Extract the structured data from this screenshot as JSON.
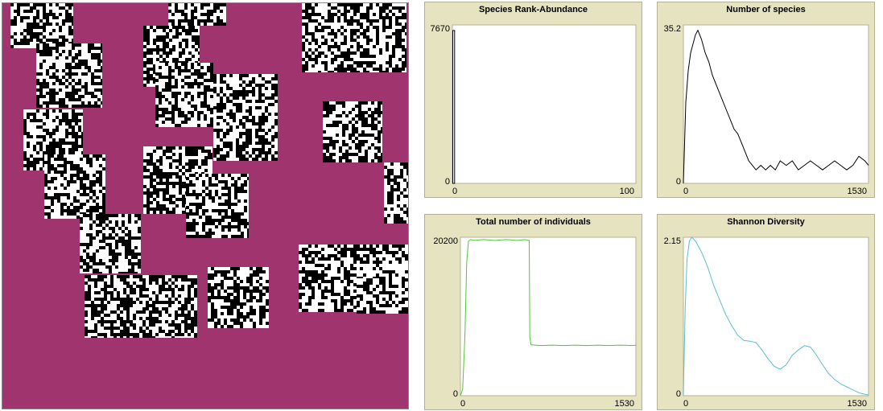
{
  "colors": {
    "world_background": "#a0346e",
    "cell_black": "#000000",
    "cell_white": "#ffffff",
    "species_line": "#000000",
    "individuals_line": "#54c43a",
    "diversity_line": "#5cbfd0",
    "panel_bg": "#e6e3c1"
  },
  "plots": [
    {
      "title": "Species Rank-Abundance",
      "y_max": "7670",
      "y_min": "0",
      "x_min": "0",
      "x_max": "100",
      "chart_data": {
        "type": "bar",
        "title": "Species Rank-Abundance",
        "xlim": [
          0,
          100
        ],
        "ylim": [
          0,
          7670
        ],
        "x": [
          1
        ],
        "values": [
          7400
        ]
      }
    },
    {
      "title": "Number of species",
      "y_max": "35.2",
      "y_min": "0",
      "x_min": "0",
      "x_max": "1530",
      "chart_data": {
        "type": "line",
        "title": "Number of species",
        "xlim": [
          0,
          1530
        ],
        "ylim": [
          0,
          35.2
        ],
        "series": [
          {
            "x": [
              0,
              20,
              40,
              60,
              80,
              100,
              120,
              150,
              180,
              210,
              240,
              270,
              300,
              330,
              360,
              390,
              420,
              450,
              480,
              510,
              540,
              570,
              600,
              640,
              680,
              720,
              760,
              800,
              850,
              900,
              950,
              1000,
              1050,
              1100,
              1150,
              1200,
              1250,
              1300,
              1350,
              1400,
              1450,
              1500,
              1530
            ],
            "values": [
              0,
              18,
              25,
              29,
              31,
              33,
              34,
              32,
              29,
              27,
              24,
              22,
              20,
              18,
              16,
              14,
              12,
              11,
              9,
              7,
              5,
              4,
              3,
              4,
              3,
              4,
              3,
              5,
              4,
              5,
              3,
              4,
              5,
              4,
              3,
              4,
              5,
              4,
              3,
              4,
              6,
              5,
              4
            ]
          }
        ]
      }
    },
    {
      "title": "Total number of individuals",
      "y_max": "20200",
      "y_min": "0",
      "x_min": "0",
      "x_max": "1530",
      "chart_data": {
        "type": "line",
        "title": "Total number of individuals",
        "xlim": [
          0,
          1530
        ],
        "ylim": [
          0,
          20200
        ],
        "series": [
          {
            "x": [
              0,
              20,
              40,
              55,
              70,
              90,
              120,
              200,
              300,
              400,
              500,
              560,
              600,
              605,
              615,
              700,
              800,
              900,
              1000,
              1100,
              1200,
              1300,
              1400,
              1500,
              1530
            ],
            "values": [
              0,
              800,
              8000,
              17000,
              19700,
              19900,
              19800,
              19900,
              19800,
              19900,
              19800,
              19900,
              19800,
              7500,
              6500,
              6400,
              6450,
              6400,
              6450,
              6400,
              6450,
              6400,
              6450,
              6400,
              6450
            ]
          }
        ]
      }
    },
    {
      "title": "Shannon Diversity",
      "y_max": "2.15",
      "y_min": "0",
      "x_min": "0",
      "x_max": "1530",
      "chart_data": {
        "type": "line",
        "title": "Shannon Diversity",
        "xlim": [
          0,
          1530
        ],
        "ylim": [
          0,
          2.15
        ],
        "series": [
          {
            "x": [
              0,
              15,
              30,
              50,
              70,
              100,
              150,
              200,
              250,
              300,
              350,
              400,
              450,
              500,
              550,
              600,
              650,
              700,
              750,
              800,
              850,
              900,
              950,
              1000,
              1050,
              1100,
              1150,
              1200,
              1250,
              1300,
              1350,
              1400,
              1450,
              1500,
              1530
            ],
            "values": [
              0,
              1.2,
              1.85,
              2.1,
              2.15,
              2.1,
              1.95,
              1.75,
              1.5,
              1.3,
              1.1,
              0.95,
              0.82,
              0.75,
              0.74,
              0.72,
              0.62,
              0.5,
              0.4,
              0.36,
              0.42,
              0.55,
              0.62,
              0.68,
              0.66,
              0.55,
              0.42,
              0.3,
              0.22,
              0.16,
              0.12,
              0.08,
              0.04,
              0.02,
              0.01
            ]
          }
        ]
      }
    }
  ]
}
